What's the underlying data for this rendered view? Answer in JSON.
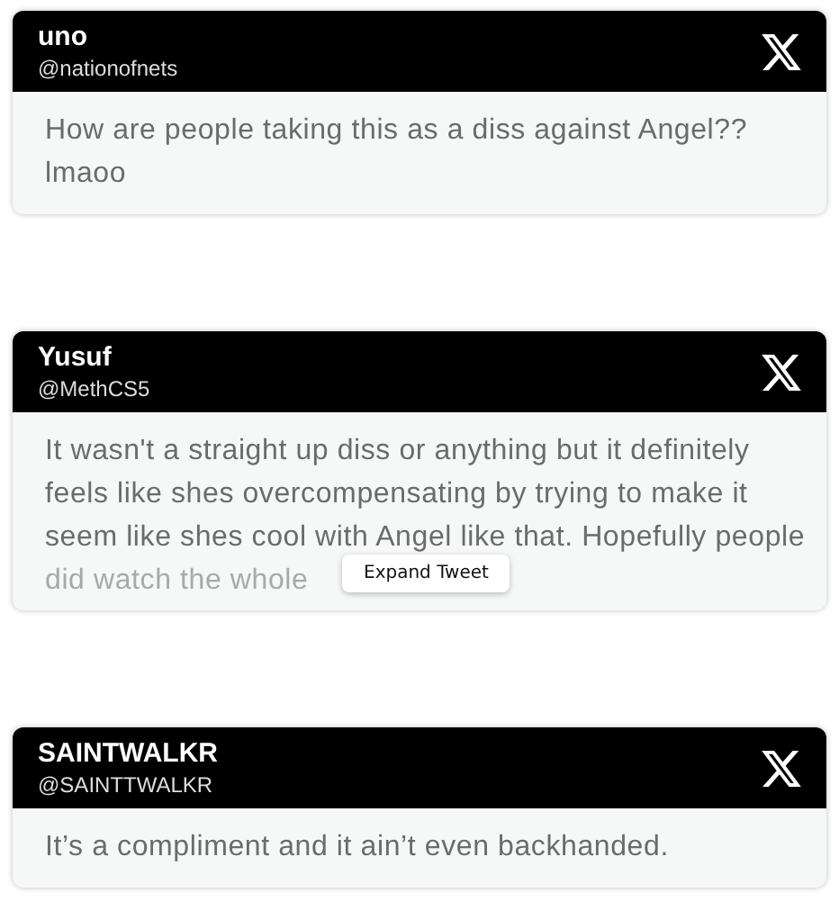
{
  "tweets": [
    {
      "name": "uno",
      "handle": "@nationofnets",
      "lines": [
        "How are people taking this as a diss against Angel??",
        "lmaoo"
      ],
      "truncated": false
    },
    {
      "name": "Yusuf",
      "handle": "@MethCS5",
      "lines": [
        "It wasn't a straight up diss or anything but it definitely",
        "feels like shes overcompensating by trying to make it",
        "seem like shes cool with Angel like that. Hopefully people",
        "did watch the whole"
      ],
      "truncated": true,
      "expand_button": "Expand Tweet"
    },
    {
      "name": "SAINTWALKR",
      "handle": "@SAINTTWALKR",
      "lines": [
        "It’s a compliment and it ain’t even backhanded."
      ],
      "truncated": false
    }
  ]
}
